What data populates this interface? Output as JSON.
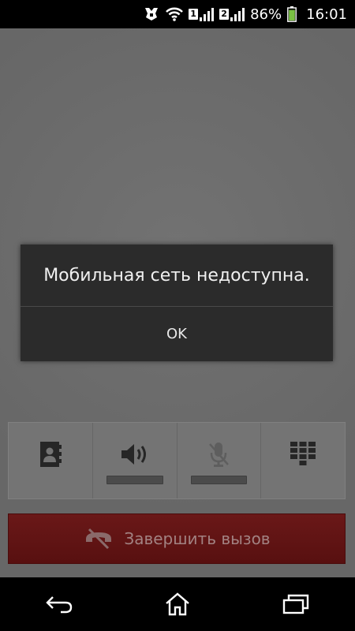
{
  "status_bar": {
    "sim1_label": "1",
    "sim2_label": "2",
    "battery_percent": "86%",
    "time": "16:01",
    "battery_color": "#7ac143"
  },
  "dialog": {
    "message": "Мобильная сеть недоступна.",
    "ok_label": "OK"
  },
  "controls": [
    {
      "name": "contacts",
      "icon": "contacts-icon",
      "has_toggle_bar": false
    },
    {
      "name": "speaker",
      "icon": "speaker-icon",
      "has_toggle_bar": true
    },
    {
      "name": "mute",
      "icon": "mic-off-icon",
      "has_toggle_bar": true
    },
    {
      "name": "dialpad",
      "icon": "dialpad-icon",
      "has_toggle_bar": false
    }
  ],
  "end_call": {
    "label": "Завершить вызов",
    "icon": "end-call-icon",
    "color": "#5e1313"
  },
  "nav_bar": {
    "buttons": [
      "back-icon",
      "home-icon",
      "recent-apps-icon"
    ]
  }
}
